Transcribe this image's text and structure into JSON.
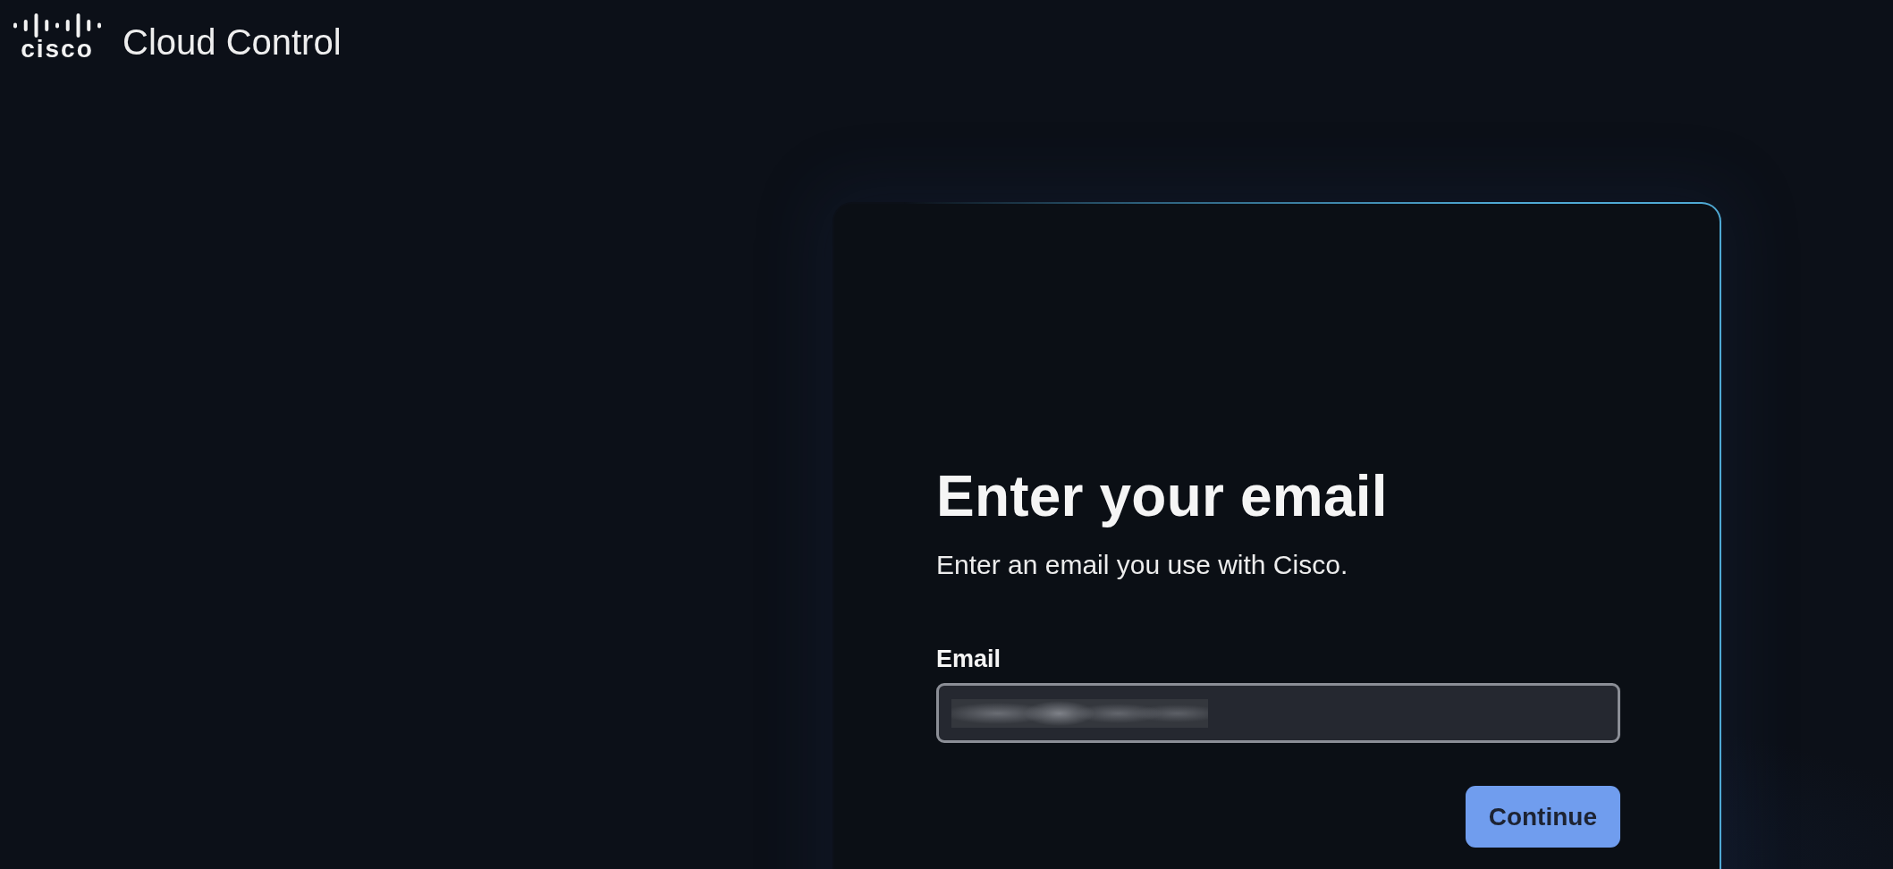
{
  "header": {
    "logo": {
      "wordmark": "cisco"
    },
    "title": "Cloud Control"
  },
  "card": {
    "title": "Enter your email",
    "subtitle": "Enter an email you use with Cisco.",
    "email_field": {
      "label": "Email",
      "value_blurred": true
    },
    "continue_button": {
      "label": "Continue"
    }
  }
}
